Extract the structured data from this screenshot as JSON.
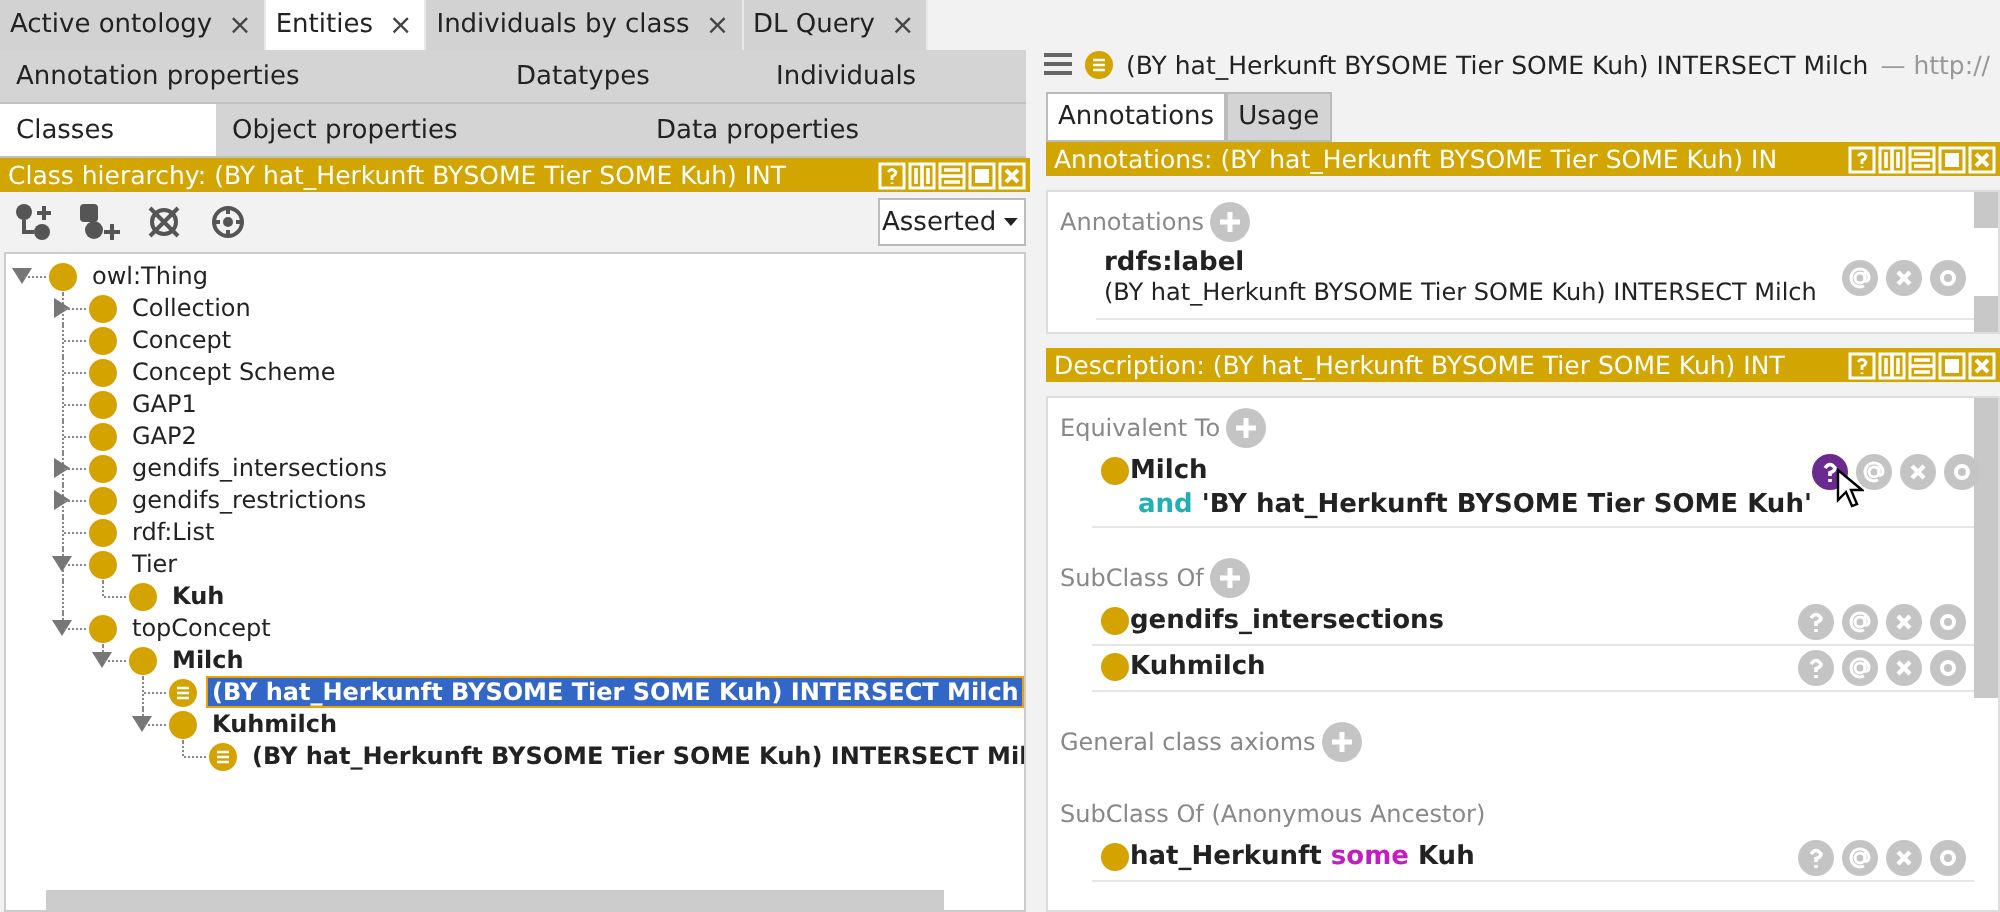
{
  "tabs": [
    {
      "label": "Active ontology",
      "close": "×",
      "selected": false
    },
    {
      "label": "Entities",
      "close": "×",
      "selected": true
    },
    {
      "label": "Individuals by class",
      "close": "×",
      "selected": false
    },
    {
      "label": "DL Query",
      "close": "×",
      "selected": false
    }
  ],
  "entity_tab_rows": [
    {
      "tabs": [
        {
          "label": "Annotation properties",
          "selected": false
        },
        {
          "label": "Datatypes",
          "selected": false
        },
        {
          "label": "Individuals",
          "selected": false
        }
      ]
    },
    {
      "tabs": [
        {
          "label": "Classes",
          "selected": true
        },
        {
          "label": "Object properties",
          "selected": false
        },
        {
          "label": "Data properties",
          "selected": false
        }
      ]
    }
  ],
  "class_hierarchy": {
    "title": "Class hierarchy: (BY hat_Herkunft BYSOME Tier SOME Kuh) INT",
    "view_mode": "Asserted",
    "tree": [
      {
        "label": "owl:Thing",
        "kind": "class",
        "bold": false,
        "has_children": true,
        "expanded": true,
        "selected": false,
        "children": [
          {
            "label": "Collection",
            "kind": "class",
            "bold": false,
            "has_children": true,
            "expanded": false,
            "selected": false
          },
          {
            "label": "Concept",
            "kind": "class",
            "bold": false,
            "has_children": false,
            "selected": false
          },
          {
            "label": "Concept Scheme",
            "kind": "class",
            "bold": false,
            "has_children": false,
            "selected": false
          },
          {
            "label": "GAP1",
            "kind": "class",
            "bold": false,
            "has_children": false,
            "selected": false
          },
          {
            "label": "GAP2",
            "kind": "class",
            "bold": false,
            "has_children": false,
            "selected": false
          },
          {
            "label": "gendifs_intersections",
            "kind": "class",
            "bold": false,
            "has_children": true,
            "expanded": false,
            "selected": false
          },
          {
            "label": "gendifs_restrictions",
            "kind": "class",
            "bold": false,
            "has_children": true,
            "expanded": false,
            "selected": false
          },
          {
            "label": "rdf:List",
            "kind": "class",
            "bold": false,
            "has_children": false,
            "selected": false
          },
          {
            "label": "Tier",
            "kind": "class",
            "bold": false,
            "has_children": true,
            "expanded": true,
            "selected": false,
            "children": [
              {
                "label": "Kuh",
                "kind": "class",
                "bold": true,
                "has_children": false,
                "selected": false
              }
            ]
          },
          {
            "label": "topConcept",
            "kind": "class",
            "bold": false,
            "has_children": true,
            "expanded": true,
            "selected": false,
            "children": [
              {
                "label": "Milch",
                "kind": "class",
                "bold": true,
                "has_children": true,
                "expanded": true,
                "selected": false,
                "children": [
                  {
                    "label": "(BY hat_Herkunft BYSOME Tier SOME Kuh) INTERSECT Milch",
                    "kind": "defined",
                    "bold": true,
                    "has_children": false,
                    "selected": true
                  },
                  {
                    "label": "Kuhmilch",
                    "kind": "class",
                    "bold": true,
                    "has_children": true,
                    "expanded": true,
                    "selected": false,
                    "children": [
                      {
                        "label": "(BY hat_Herkunft BYSOME Tier SOME Kuh) INTERSECT Mil",
                        "kind": "defined",
                        "bold": true,
                        "has_children": false,
                        "selected": false
                      }
                    ]
                  }
                ]
              }
            ]
          }
        ]
      }
    ]
  },
  "entity": {
    "title": "(BY hat_Herkunft BYSOME Tier SOME Kuh) INTERSECT Milch",
    "iri": "— http://"
  },
  "view_tabs": [
    {
      "label": "Annotations",
      "selected": true
    },
    {
      "label": "Usage",
      "selected": false
    }
  ],
  "annotations_panel": {
    "title": "Annotations: (BY hat_Herkunft BYSOME Tier SOME Kuh) IN",
    "heading": "Annotations",
    "items": [
      {
        "property": "rdfs:label",
        "value": "(BY hat_Herkunft BYSOME Tier SOME Kuh) INTERSECT Milch"
      }
    ]
  },
  "description_panel": {
    "title": "Description: (BY hat_Herkunft BYSOME Tier SOME Kuh) INT",
    "sections": [
      {
        "heading": "Equivalent To",
        "addable": true,
        "items": [
          {
            "lines": [
              [
                {
                  "text": "Milch",
                  "kind": "name"
                }
              ],
              [
                {
                  "text": "and",
                  "kind": "keyword",
                  "color": "#1fb0b4"
                },
                {
                  "text": "'BY hat_Herkunft BYSOME Tier SOME Kuh'",
                  "kind": "name"
                }
              ]
            ],
            "explain_hovered": true
          }
        ]
      },
      {
        "heading": "SubClass Of",
        "addable": true,
        "items": [
          {
            "lines": [
              [
                {
                  "text": "gendifs_intersections",
                  "kind": "name"
                }
              ]
            ],
            "explain_hovered": false
          },
          {
            "lines": [
              [
                {
                  "text": "Kuhmilch",
                  "kind": "name"
                }
              ]
            ],
            "explain_hovered": false
          }
        ]
      },
      {
        "heading": "General class axioms",
        "addable": true
      },
      {
        "heading": "SubClass Of (Anonymous Ancestor)",
        "addable": false,
        "items": [
          {
            "lines": [
              [
                {
                  "text": "hat_Herkunft",
                  "kind": "name"
                },
                {
                  "text": "some",
                  "kind": "keyword",
                  "color": "#c21cc2"
                },
                {
                  "text": "Kuh",
                  "kind": "name"
                }
              ]
            ],
            "explain_hovered": false
          }
        ]
      }
    ]
  }
}
